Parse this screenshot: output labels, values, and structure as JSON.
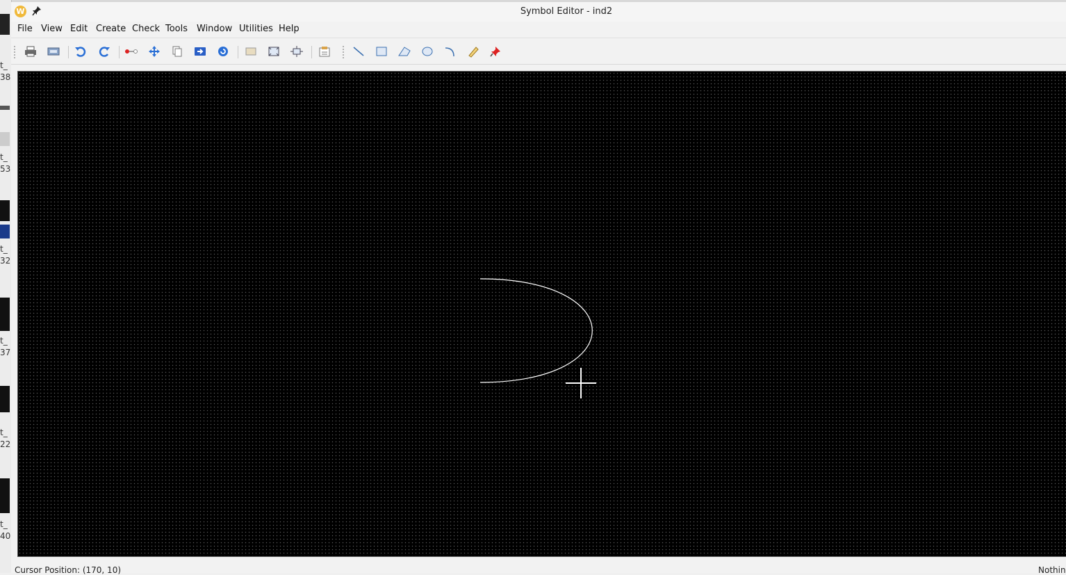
{
  "window": {
    "title": "Symbol Editor - ind2"
  },
  "menubar": {
    "items": [
      "File",
      "View",
      "Edit",
      "Create",
      "Check",
      "Tools",
      "Window",
      "Utilities",
      "Help"
    ]
  },
  "toolbar": {
    "icons": [
      "print-icon",
      "export-icon",
      "undo-icon",
      "redo-icon",
      "stretch-icon",
      "move-icon",
      "copy-icon",
      "hierarchy-icon",
      "rotate-icon",
      "zoom-fit-icon",
      "zoom-box-icon",
      "pan-icon",
      "properties-icon",
      "line-icon",
      "rectangle-icon",
      "polygon-icon",
      "circle-icon",
      "arc-icon",
      "note-icon",
      "pin-icon"
    ]
  },
  "background": {
    "left_labels": [
      "t_\n38",
      "t_\n53",
      "t_\n32",
      "t_\n37",
      "t_\n22",
      "t_\n40"
    ]
  },
  "canvas": {
    "background": "#000000",
    "stroke": "#ffffff"
  },
  "status": {
    "cursor_position": "Cursor Position: (170, 10)",
    "mode": "Nothin"
  }
}
